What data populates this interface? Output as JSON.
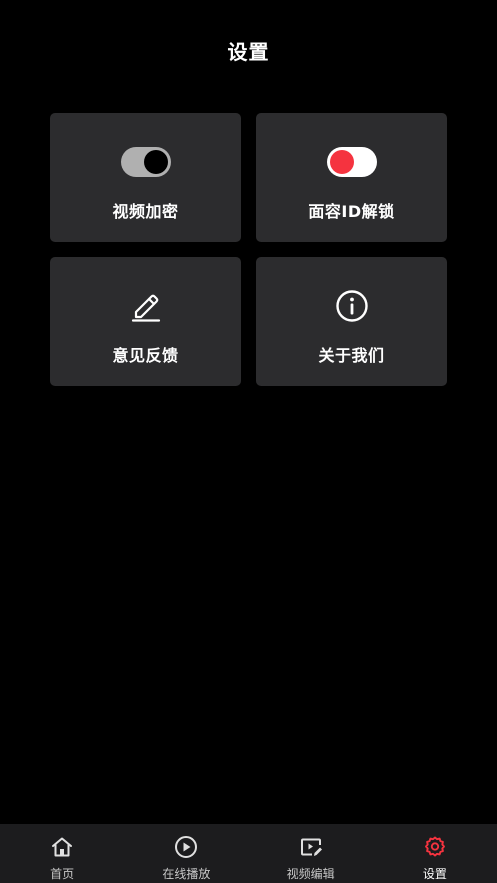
{
  "header": {
    "title": "设置"
  },
  "cards": [
    {
      "label": "视频加密",
      "icon": "toggle-off-icon",
      "toggle_on": false
    },
    {
      "label": "面容ID解锁",
      "icon": "toggle-on-icon",
      "toggle_on": true
    },
    {
      "label": "意见反馈",
      "icon": "edit-pen-icon"
    },
    {
      "label": "关于我们",
      "icon": "info-circle-icon"
    }
  ],
  "tabbar": {
    "items": [
      {
        "label": "首页",
        "icon": "home-icon",
        "active": false
      },
      {
        "label": "在线播放",
        "icon": "play-circle-icon",
        "active": false
      },
      {
        "label": "视频编辑",
        "icon": "video-edit-icon",
        "active": false
      },
      {
        "label": "设置",
        "icon": "gear-icon",
        "active": true
      }
    ]
  },
  "colors": {
    "background": "#000000",
    "card": "#2c2c2e",
    "tabbar": "#1c1c1e",
    "accent": "#f5333f",
    "toggle_off_track": "#b0b0b0"
  }
}
